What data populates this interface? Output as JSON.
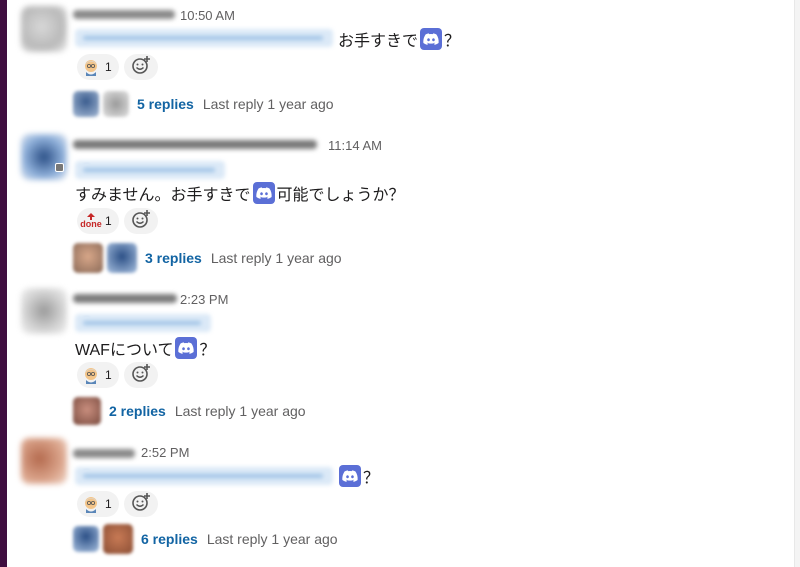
{
  "messages": [
    {
      "time": "10:50 AM",
      "text_before": "お手すきで",
      "text_after": "？",
      "reaction": {
        "emoji": "old-person-emoji",
        "count": "1"
      },
      "thread": {
        "replies": "5 replies",
        "last_reply": "Last reply 1 year ago"
      }
    },
    {
      "time": "11:14 AM",
      "text_before": "すみません。お手すきで",
      "text_after": "可能でしょうか？",
      "reaction": {
        "emoji": "done-emoji",
        "count": "1"
      },
      "thread": {
        "replies": "3 replies",
        "last_reply": "Last reply 1 year ago"
      }
    },
    {
      "time": "2:23 PM",
      "text_before": "WAFについて",
      "text_after": "？",
      "reaction": {
        "emoji": "old-person-emoji",
        "count": "1"
      },
      "thread": {
        "replies": "2 replies",
        "last_reply": "Last reply 1 year ago"
      }
    },
    {
      "time": "2:52 PM",
      "text_before": "",
      "text_after": "？",
      "reaction": {
        "emoji": "old-person-emoji",
        "count": "1"
      },
      "thread": {
        "replies": "6 replies",
        "last_reply": "Last reply 1 year ago"
      }
    }
  ],
  "done_emoji_text": "done",
  "at_symbol": "@",
  "colors": {
    "link": "#1264a3",
    "discord": "#5b6fd6",
    "mention_bg": "#dbe9f7",
    "sidebar": "#3f0e40"
  }
}
